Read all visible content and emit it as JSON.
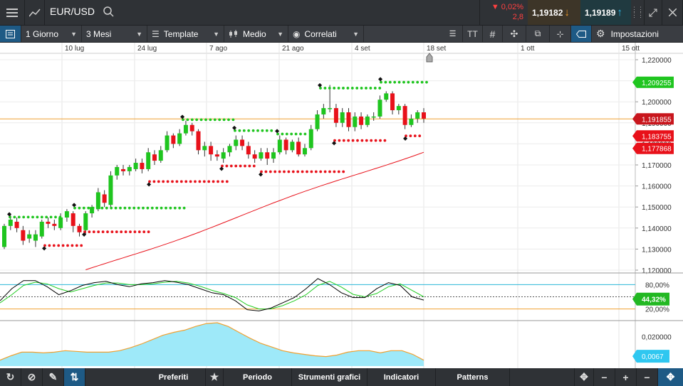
{
  "header": {
    "symbol": "EUR/USD",
    "change_pct": "▼ 0,02%",
    "change_pips": "2,8",
    "bid": "1,19182",
    "ask": "1,19189"
  },
  "toolbar": {
    "interval": "1 Giorno",
    "range": "3 Mesi",
    "template": "Template",
    "chart_style": "Medio",
    "correlated": "Correlati",
    "settings": "Impostazioni"
  },
  "bottom": {
    "favorites": "Preferiti",
    "period": "Periodo",
    "drawing_tools": "Strumenti grafici",
    "indicators": "Indicatori",
    "patterns": "Patterns"
  },
  "colors": {
    "up": "#1fc51f",
    "down": "#e8111a",
    "price_line": "#f0a030",
    "ma_line": "#e8111a",
    "stoch_fast": "#000000",
    "stoch_slow": "#22cc22",
    "osc_fill": "#9ee9f9",
    "osc_line": "#f0a030"
  },
  "chart_data": [
    {
      "type": "candlestick",
      "x_ticks": [
        "10 lug",
        "24 lug",
        "7 ago",
        "21 ago",
        "4 set",
        "18 set",
        "1 ott",
        "15 ott"
      ],
      "y_ticks": [
        "1,220000",
        "1,210000",
        "1,200000",
        "1,190000",
        "1,180000",
        "1,170000",
        "1,160000",
        "1,150000",
        "1,140000",
        "1,130000",
        "1,120000"
      ],
      "ylim": [
        1.12,
        1.22
      ],
      "price_labels": [
        {
          "text": "1,209255",
          "value": 1.209255,
          "color": "#1fc51f"
        },
        {
          "text": "1,191855",
          "value": 1.191855,
          "color": "#c8161d"
        },
        {
          "text": "1,183755",
          "value": 1.183755,
          "color": "#e8111a"
        },
        {
          "text": "1,177868",
          "value": 1.177868,
          "color": "#e8111a"
        }
      ],
      "candles": [
        [
          1.131,
          1.141,
          1.13,
          1.142
        ],
        [
          1.141,
          1.144,
          1.139,
          1.146
        ],
        [
          1.143,
          1.14,
          1.138,
          1.145
        ],
        [
          1.139,
          1.134,
          1.132,
          1.141
        ],
        [
          1.135,
          1.137,
          1.133,
          1.139
        ],
        [
          1.134,
          1.137,
          1.131,
          1.139
        ],
        [
          1.136,
          1.143,
          1.135,
          1.144
        ],
        [
          1.143,
          1.142,
          1.14,
          1.145
        ],
        [
          1.142,
          1.141,
          1.139,
          1.144
        ],
        [
          1.14,
          1.145,
          1.139,
          1.147
        ],
        [
          1.145,
          1.148,
          1.143,
          1.149
        ],
        [
          1.147,
          1.141,
          1.138,
          1.148
        ],
        [
          1.141,
          1.138,
          1.136,
          1.142
        ],
        [
          1.139,
          1.147,
          1.137,
          1.148
        ],
        [
          1.147,
          1.15,
          1.145,
          1.151
        ],
        [
          1.149,
          1.157,
          1.148,
          1.159
        ],
        [
          1.156,
          1.152,
          1.15,
          1.158
        ],
        [
          1.151,
          1.165,
          1.15,
          1.167
        ],
        [
          1.165,
          1.169,
          1.163,
          1.17
        ],
        [
          1.168,
          1.167,
          1.165,
          1.17
        ],
        [
          1.167,
          1.169,
          1.165,
          1.17
        ],
        [
          1.168,
          1.171,
          1.167,
          1.173
        ],
        [
          1.171,
          1.168,
          1.166,
          1.173
        ],
        [
          1.168,
          1.176,
          1.167,
          1.178
        ],
        [
          1.175,
          1.172,
          1.17,
          1.177
        ],
        [
          1.172,
          1.177,
          1.171,
          1.179
        ],
        [
          1.177,
          1.184,
          1.176,
          1.186
        ],
        [
          1.184,
          1.18,
          1.178,
          1.185
        ],
        [
          1.18,
          1.185,
          1.179,
          1.187
        ],
        [
          1.185,
          1.189,
          1.184,
          1.191
        ],
        [
          1.189,
          1.186,
          1.184,
          1.19
        ],
        [
          1.186,
          1.177,
          1.175,
          1.187
        ],
        [
          1.177,
          1.179,
          1.174,
          1.181
        ],
        [
          1.179,
          1.175,
          1.172,
          1.181
        ],
        [
          1.175,
          1.174,
          1.172,
          1.177
        ],
        [
          1.173,
          1.176,
          1.171,
          1.178
        ],
        [
          1.176,
          1.179,
          1.174,
          1.18
        ],
        [
          1.179,
          1.182,
          1.177,
          1.184
        ],
        [
          1.182,
          1.179,
          1.177,
          1.184
        ],
        [
          1.179,
          1.175,
          1.173,
          1.181
        ],
        [
          1.175,
          1.173,
          1.171,
          1.177
        ],
        [
          1.173,
          1.176,
          1.172,
          1.178
        ],
        [
          1.176,
          1.173,
          1.17,
          1.178
        ],
        [
          1.173,
          1.176,
          1.171,
          1.178
        ],
        [
          1.176,
          1.182,
          1.175,
          1.184
        ],
        [
          1.182,
          1.177,
          1.175,
          1.183
        ],
        [
          1.177,
          1.181,
          1.176,
          1.182
        ],
        [
          1.181,
          1.175,
          1.174,
          1.183
        ],
        [
          1.175,
          1.178,
          1.174,
          1.18
        ],
        [
          1.178,
          1.187,
          1.177,
          1.189
        ],
        [
          1.187,
          1.194,
          1.186,
          1.196
        ],
        [
          1.194,
          1.197,
          1.192,
          1.199
        ],
        [
          1.197,
          1.197,
          1.195,
          1.208
        ],
        [
          1.197,
          1.19,
          1.188,
          1.199
        ],
        [
          1.19,
          1.195,
          1.188,
          1.197
        ],
        [
          1.195,
          1.188,
          1.186,
          1.197
        ],
        [
          1.188,
          1.193,
          1.186,
          1.195
        ],
        [
          1.193,
          1.189,
          1.187,
          1.195
        ],
        [
          1.189,
          1.193,
          1.188,
          1.194
        ],
        [
          1.193,
          1.193,
          1.191,
          1.195
        ],
        [
          1.193,
          1.201,
          1.192,
          1.203
        ],
        [
          1.201,
          1.204,
          1.2,
          1.205
        ],
        [
          1.204,
          1.196,
          1.194,
          1.205
        ],
        [
          1.196,
          1.198,
          1.194,
          1.199
        ],
        [
          1.198,
          1.189,
          1.187,
          1.199
        ],
        [
          1.189,
          1.192,
          1.188,
          1.194
        ],
        [
          1.192,
          1.195,
          1.19,
          1.196
        ],
        [
          1.195,
          1.192,
          1.19,
          1.197
        ]
      ]
    },
    {
      "type": "line",
      "y_ticks": [
        "80,00%",
        "20,00%"
      ],
      "value_label": "44,32%"
    },
    {
      "type": "area",
      "y_ticks": [
        "0,020000"
      ],
      "value_label": "0,0067"
    }
  ]
}
